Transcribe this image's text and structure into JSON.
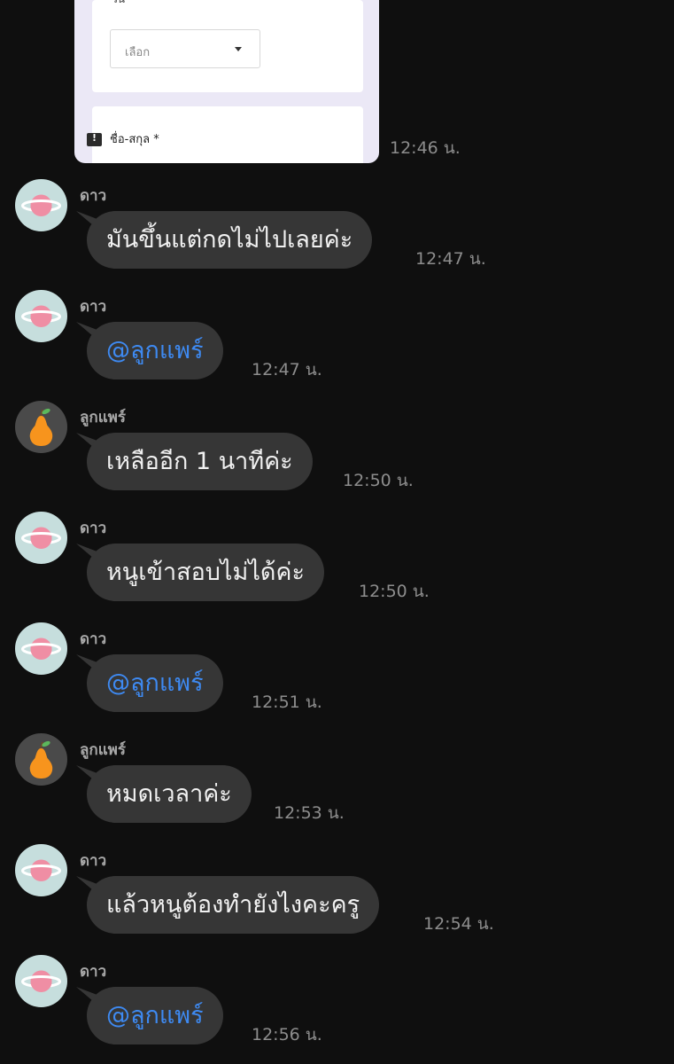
{
  "form_preview": {
    "select_placeholder": "เลือก",
    "name_field_label": "ชื่อ-สกุล *",
    "time": "12:46 น."
  },
  "senders": {
    "dao": "ดาว",
    "lukpae": "ลูกแพร์"
  },
  "avatar_icons": {
    "dao": "pink-planet-avatar-icon",
    "lukpae": "orange-pear-avatar-icon"
  },
  "messages": [
    {
      "sender": "ดาว",
      "text": "มันขึ้นแต่กดไม่ไปเลยค่ะ",
      "time": "12:47 น."
    },
    {
      "sender": "ดาว",
      "text": "@ลูกแพร์",
      "time": "12:47 น."
    },
    {
      "sender": "ลูกแพร์",
      "text": "เหลืออีก 1 นาทีค่ะ",
      "time": "12:50 น."
    },
    {
      "sender": "ดาว",
      "text": "หนูเข้าสอบไม่ได้ค่ะ",
      "time": "12:50 น."
    },
    {
      "sender": "ดาว",
      "text": "@ลูกแพร์",
      "time": "12:51 น."
    },
    {
      "sender": "ลูกแพร์",
      "text": "หมดเวลาค่ะ",
      "time": "12:53 น."
    },
    {
      "sender": "ดาว",
      "text": "แล้วหนูต้องทำยังไงคะครู",
      "time": "12:54 น."
    },
    {
      "sender": "ดาว",
      "text": "@ลูกแพร์",
      "time": "12:56 น."
    }
  ],
  "colors": {
    "background": "#0f0f0f",
    "bubble": "#363636",
    "mention": "#3e8af2"
  }
}
